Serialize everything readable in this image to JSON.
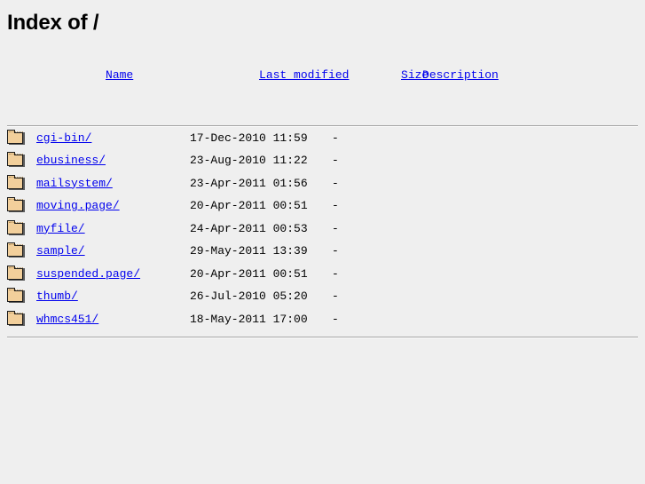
{
  "page": {
    "title": "Index of /",
    "background_color": "#efefef",
    "link_color": "#0000ee",
    "rule_color": "#a6a6a6"
  },
  "table": {
    "columns": [
      {
        "key": "icon",
        "label": ""
      },
      {
        "key": "name",
        "label": "Name"
      },
      {
        "key": "modified",
        "label": "Last modified"
      },
      {
        "key": "size",
        "label": "Size"
      },
      {
        "key": "description",
        "label": "Description"
      }
    ],
    "rows": [
      {
        "icon": "folder-icon",
        "name": "cgi-bin/",
        "modified": "17-Dec-2010 11:59",
        "size": "-",
        "description": ""
      },
      {
        "icon": "folder-icon",
        "name": "ebusiness/",
        "modified": "23-Aug-2010 11:22",
        "size": "-",
        "description": ""
      },
      {
        "icon": "folder-icon",
        "name": "mailsystem/",
        "modified": "23-Apr-2011 01:56",
        "size": "-",
        "description": ""
      },
      {
        "icon": "folder-icon",
        "name": "moving.page/",
        "modified": "20-Apr-2011 00:51",
        "size": "-",
        "description": ""
      },
      {
        "icon": "folder-icon",
        "name": "myfile/",
        "modified": "24-Apr-2011 00:53",
        "size": "-",
        "description": ""
      },
      {
        "icon": "folder-icon",
        "name": "sample/",
        "modified": "29-May-2011 13:39",
        "size": "-",
        "description": ""
      },
      {
        "icon": "folder-icon",
        "name": "suspended.page/",
        "modified": "20-Apr-2011 00:51",
        "size": "-",
        "description": ""
      },
      {
        "icon": "folder-icon",
        "name": "thumb/",
        "modified": "26-Jul-2010 05:20",
        "size": "-",
        "description": ""
      },
      {
        "icon": "folder-icon",
        "name": "whmcs451/",
        "modified": "18-May-2011 17:00",
        "size": "-",
        "description": ""
      }
    ]
  }
}
